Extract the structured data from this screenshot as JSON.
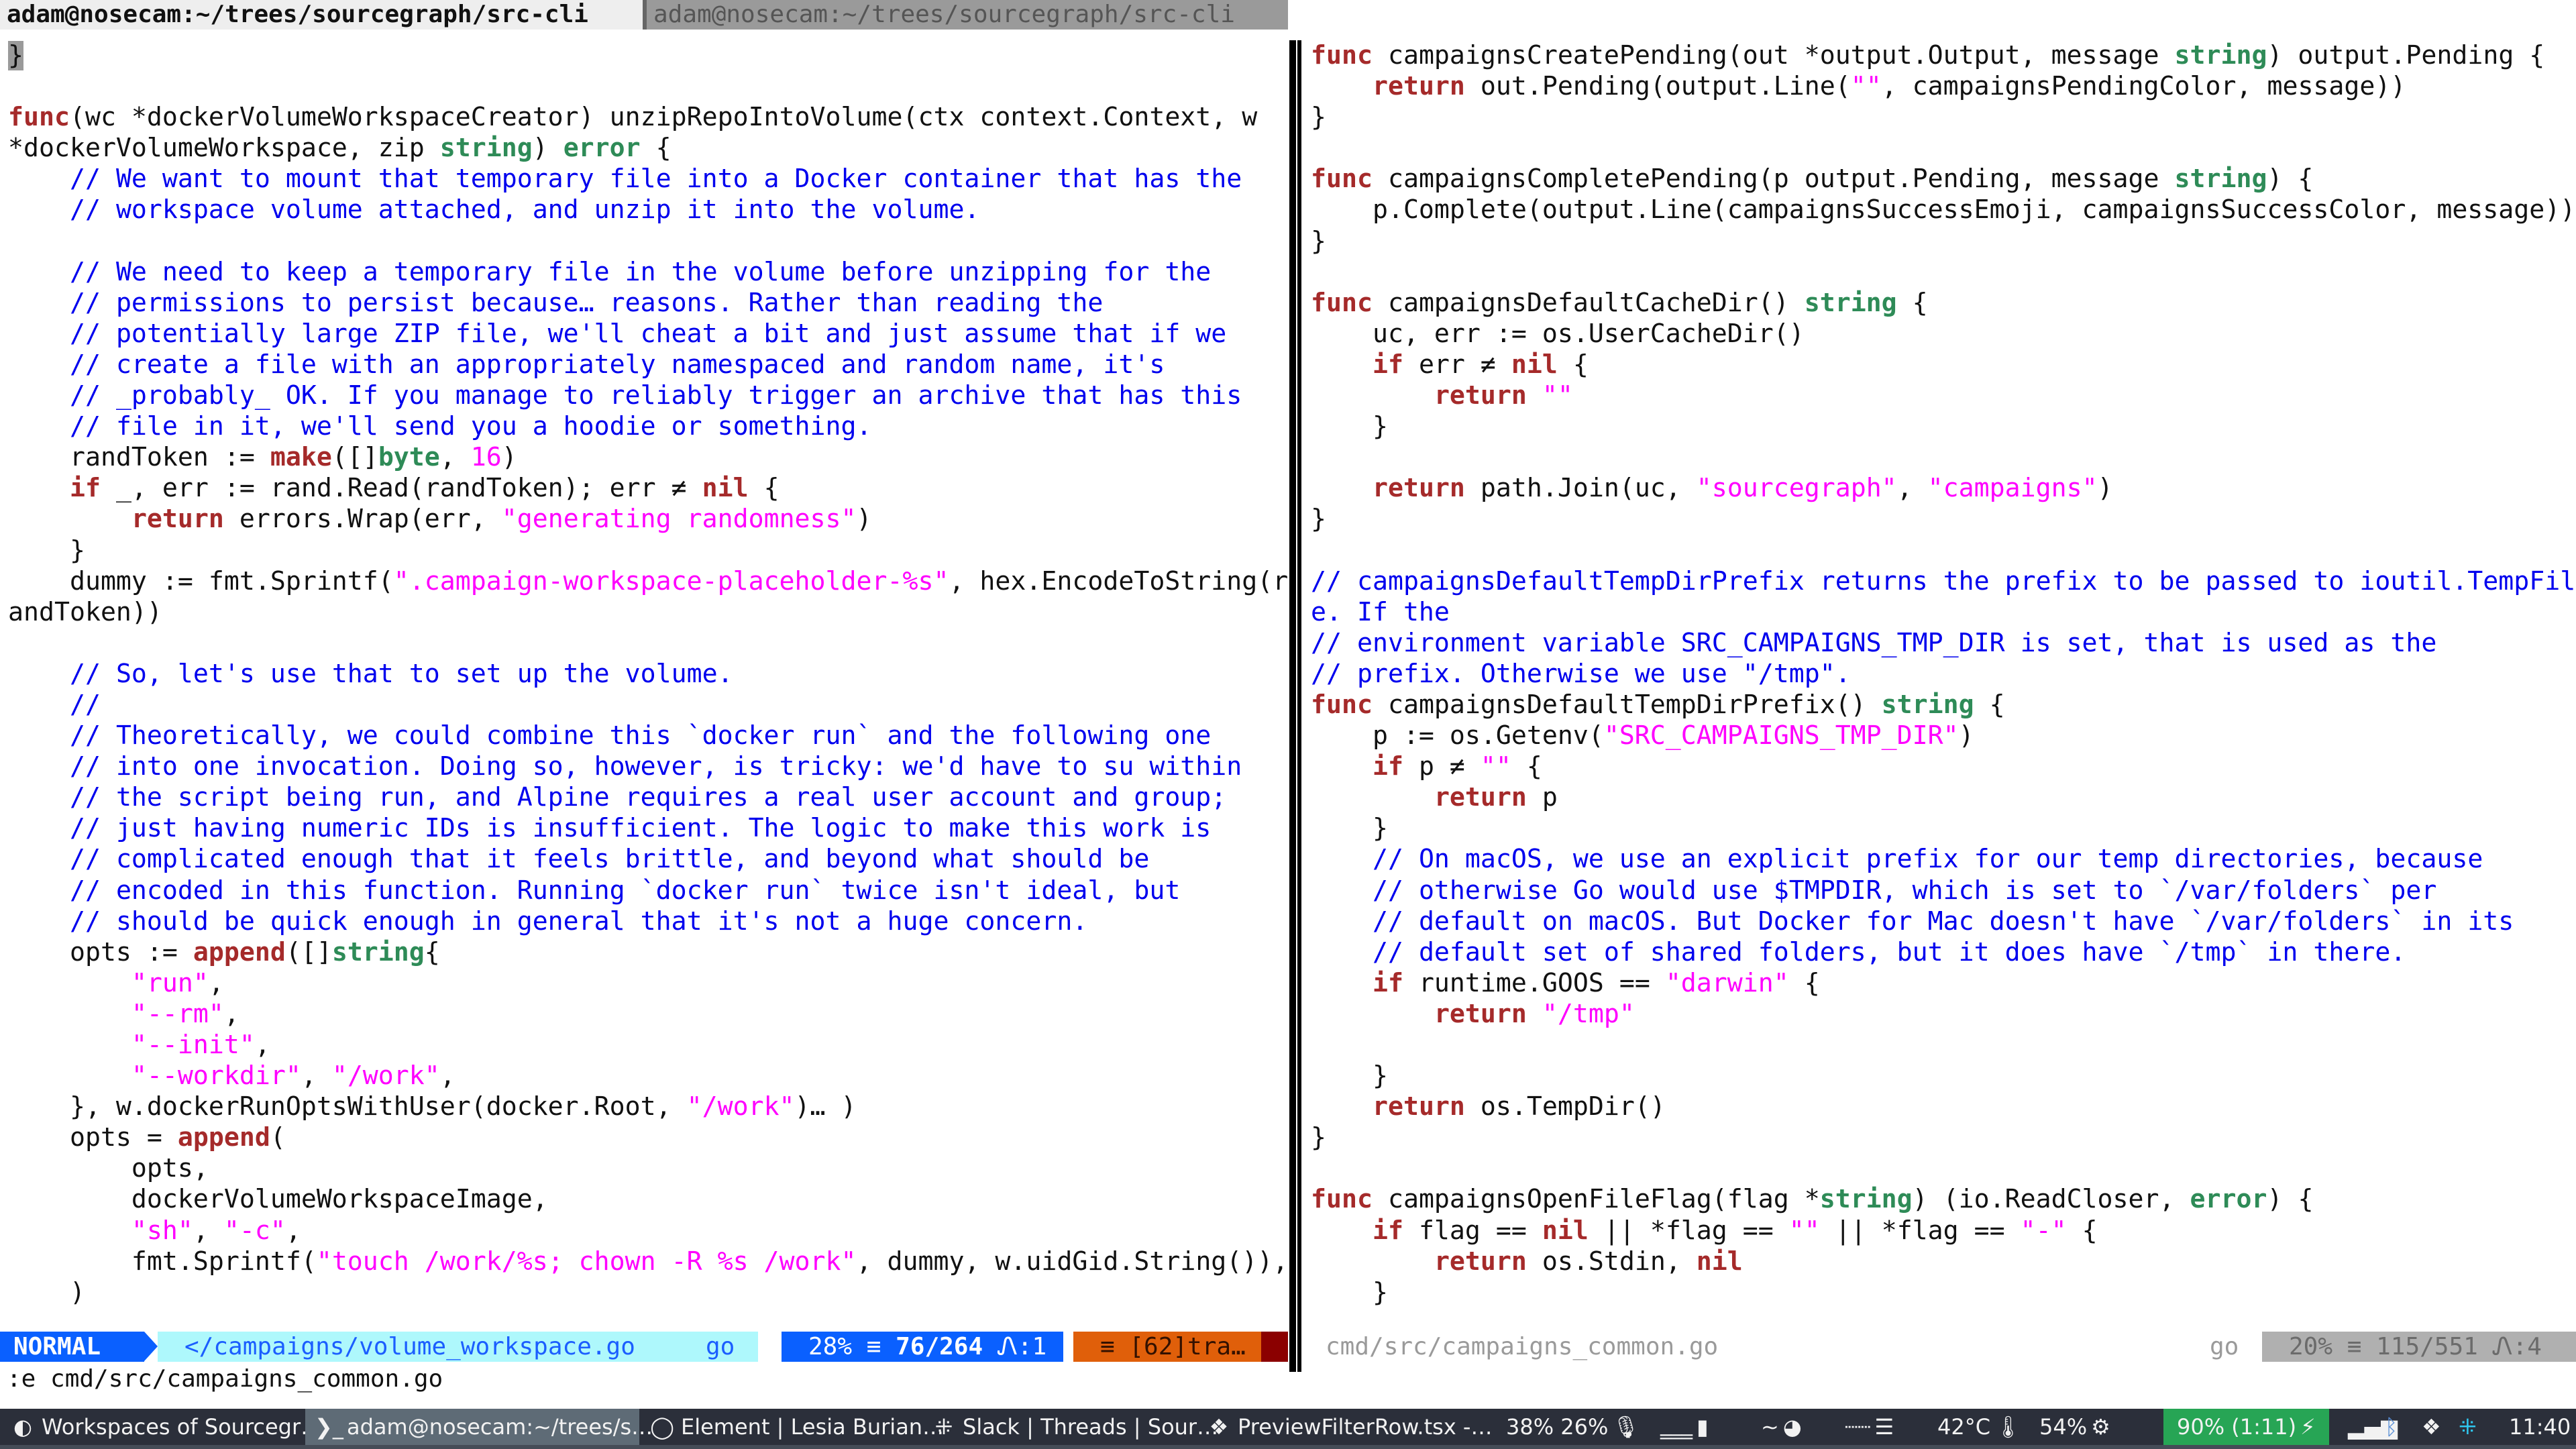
{
  "titlebar": {
    "active_tab": "adam@nosecam:~/trees/sourcegraph/src-cli",
    "inactive_tab": "adam@nosecam:~/trees/sourcegraph/src-cli"
  },
  "left_pane": {
    "file": "volume_workspace.go",
    "lines": [
      [
        [
          "cursor",
          "}"
        ]
      ],
      [],
      [
        [
          "kw",
          "func"
        ],
        [
          "",
          "(wc *dockerVolumeWorkspaceCreator) unzipRepoIntoVolume(ctx context.Context, w"
        ]
      ],
      [
        [
          "",
          "*dockerVolumeWorkspace, zip "
        ],
        [
          "ty",
          "string"
        ],
        [
          "",
          ") "
        ],
        [
          "ty",
          "error"
        ],
        [
          "",
          " {"
        ]
      ],
      [
        [
          "",
          "    "
        ],
        [
          "cm",
          "// We want to mount that temporary file into a Docker container that has the"
        ]
      ],
      [
        [
          "",
          "    "
        ],
        [
          "cm",
          "// workspace volume attached, and unzip it into the volume."
        ]
      ],
      [],
      [
        [
          "",
          "    "
        ],
        [
          "cm",
          "// We need to keep a temporary file in the volume before unzipping for the"
        ]
      ],
      [
        [
          "",
          "    "
        ],
        [
          "cm",
          "// permissions to persist because… reasons. Rather than reading the"
        ]
      ],
      [
        [
          "",
          "    "
        ],
        [
          "cm",
          "// potentially large ZIP file, we'll cheat a bit and just assume that if we"
        ]
      ],
      [
        [
          "",
          "    "
        ],
        [
          "cm",
          "// create a file with an appropriately namespaced and random name, it's"
        ]
      ],
      [
        [
          "",
          "    "
        ],
        [
          "cm",
          "// _probably_ OK. If you manage to reliably trigger an archive that has this"
        ]
      ],
      [
        [
          "",
          "    "
        ],
        [
          "cm",
          "// file in it, we'll send you a hoodie or something."
        ]
      ],
      [
        [
          "",
          "    randToken := "
        ],
        [
          "kw",
          "make"
        ],
        [
          "",
          "([]"
        ],
        [
          "ty",
          "byte"
        ],
        [
          "",
          ", "
        ],
        [
          "nu",
          "16"
        ],
        [
          "",
          ")"
        ]
      ],
      [
        [
          "",
          "    "
        ],
        [
          "kw",
          "if"
        ],
        [
          "",
          " _, err := rand.Read(randToken); err ≠ "
        ],
        [
          "kw",
          "nil"
        ],
        [
          "",
          " {"
        ]
      ],
      [
        [
          "",
          "        "
        ],
        [
          "kw",
          "return"
        ],
        [
          "",
          " errors.Wrap(err, "
        ],
        [
          "st",
          "\"generating randomness\""
        ],
        [
          "",
          ")"
        ]
      ],
      [
        [
          "",
          "    }"
        ]
      ],
      [
        [
          "",
          "    dummy := fmt.Sprintf("
        ],
        [
          "st",
          "\".campaign-workspace-placeholder-%s\""
        ],
        [
          "",
          ", hex.EncodeToString(r"
        ]
      ],
      [
        [
          "",
          "andToken))"
        ]
      ],
      [],
      [
        [
          "",
          "    "
        ],
        [
          "cm",
          "// So, let's use that to set up the volume."
        ]
      ],
      [
        [
          "",
          "    "
        ],
        [
          "cm",
          "//"
        ]
      ],
      [
        [
          "",
          "    "
        ],
        [
          "cm",
          "// Theoretically, we could combine this `docker run` and the following one"
        ]
      ],
      [
        [
          "",
          "    "
        ],
        [
          "cm",
          "// into one invocation. Doing so, however, is tricky: we'd have to su within"
        ]
      ],
      [
        [
          "",
          "    "
        ],
        [
          "cm",
          "// the script being run, and Alpine requires a real user account and group;"
        ]
      ],
      [
        [
          "",
          "    "
        ],
        [
          "cm",
          "// just having numeric IDs is insufficient. The logic to make this work is"
        ]
      ],
      [
        [
          "",
          "    "
        ],
        [
          "cm",
          "// complicated enough that it feels brittle, and beyond what should be"
        ]
      ],
      [
        [
          "",
          "    "
        ],
        [
          "cm",
          "// encoded in this function. Running `docker run` twice isn't ideal, but"
        ]
      ],
      [
        [
          "",
          "    "
        ],
        [
          "cm",
          "// should be quick enough in general that it's not a huge concern."
        ]
      ],
      [
        [
          "",
          "    opts := "
        ],
        [
          "kw",
          "append"
        ],
        [
          "",
          "([]"
        ],
        [
          "ty",
          "string"
        ],
        [
          "",
          "{"
        ]
      ],
      [
        [
          "",
          "        "
        ],
        [
          "st",
          "\"run\""
        ],
        [
          "",
          ","
        ]
      ],
      [
        [
          "",
          "        "
        ],
        [
          "st",
          "\"--rm\""
        ],
        [
          "",
          ","
        ]
      ],
      [
        [
          "",
          "        "
        ],
        [
          "st",
          "\"--init\""
        ],
        [
          "",
          ","
        ]
      ],
      [
        [
          "",
          "        "
        ],
        [
          "st",
          "\"--workdir\""
        ],
        [
          "",
          ", "
        ],
        [
          "st",
          "\"/work\""
        ],
        [
          "",
          ","
        ]
      ],
      [
        [
          "",
          "    }, w.dockerRunOptsWithUser(docker.Root, "
        ],
        [
          "st",
          "\"/work\""
        ],
        [
          "",
          ")… )"
        ]
      ],
      [
        [
          "",
          "    opts = "
        ],
        [
          "kw",
          "append"
        ],
        [
          "",
          "("
        ]
      ],
      [
        [
          "",
          "        opts,"
        ]
      ],
      [
        [
          "",
          "        dockerVolumeWorkspaceImage,"
        ]
      ],
      [
        [
          "",
          "        "
        ],
        [
          "st",
          "\"sh\""
        ],
        [
          "",
          ", "
        ],
        [
          "st",
          "\"-c\""
        ],
        [
          "",
          ","
        ]
      ],
      [
        [
          "",
          "        fmt.Sprintf("
        ],
        [
          "st",
          "\"touch /work/%s; chown -R %s /work\""
        ],
        [
          "",
          ", dummy, w.uidGid.String()),"
        ]
      ],
      [
        [
          "",
          "    )"
        ]
      ]
    ]
  },
  "right_pane": {
    "file": "campaigns_common.go",
    "lines": [
      [
        [
          "kw",
          "func"
        ],
        [
          "",
          " campaignsCreatePending(out *output.Output, message "
        ],
        [
          "ty",
          "string"
        ],
        [
          "",
          ") output.Pending {"
        ]
      ],
      [
        [
          "",
          "    "
        ],
        [
          "kw",
          "return"
        ],
        [
          "",
          " out.Pending(output.Line("
        ],
        [
          "st",
          "\"\""
        ],
        [
          "",
          ", campaignsPendingColor, message))"
        ]
      ],
      [
        [
          "",
          "}"
        ]
      ],
      [],
      [
        [
          "kw",
          "func"
        ],
        [
          "",
          " campaignsCompletePending(p output.Pending, message "
        ],
        [
          "ty",
          "string"
        ],
        [
          "",
          ") {"
        ]
      ],
      [
        [
          "",
          "    p.Complete(output.Line(campaignsSuccessEmoji, campaignsSuccessColor, message))"
        ]
      ],
      [
        [
          "",
          "}"
        ]
      ],
      [],
      [
        [
          "kw",
          "func"
        ],
        [
          "",
          " campaignsDefaultCacheDir() "
        ],
        [
          "ty",
          "string"
        ],
        [
          "",
          " {"
        ]
      ],
      [
        [
          "",
          "    uc, err := os.UserCacheDir()"
        ]
      ],
      [
        [
          "",
          "    "
        ],
        [
          "kw",
          "if"
        ],
        [
          "",
          " err ≠ "
        ],
        [
          "kw",
          "nil"
        ],
        [
          "",
          " {"
        ]
      ],
      [
        [
          "",
          "        "
        ],
        [
          "kw",
          "return"
        ],
        [
          "",
          ""
        ],
        [
          "st",
          " \"\""
        ]
      ],
      [
        [
          "",
          "    }"
        ]
      ],
      [],
      [
        [
          "",
          "    "
        ],
        [
          "kw",
          "return"
        ],
        [
          "",
          " path.Join(uc, "
        ],
        [
          "st",
          "\"sourcegraph\""
        ],
        [
          "",
          ", "
        ],
        [
          "st",
          "\"campaigns\""
        ],
        [
          "",
          ")"
        ]
      ],
      [
        [
          "",
          "}"
        ]
      ],
      [],
      [
        [
          "cm",
          "// campaignsDefaultTempDirPrefix returns the prefix to be passed to ioutil.TempFil"
        ]
      ],
      [
        [
          "cm",
          "e. If the"
        ]
      ],
      [
        [
          "cm",
          "// environment variable SRC_CAMPAIGNS_TMP_DIR is set, that is used as the"
        ]
      ],
      [
        [
          "cm",
          "// prefix. Otherwise we use \"/tmp\"."
        ]
      ],
      [
        [
          "kw",
          "func"
        ],
        [
          "",
          " campaignsDefaultTempDirPrefix() "
        ],
        [
          "ty",
          "string"
        ],
        [
          "",
          " {"
        ]
      ],
      [
        [
          "",
          "    p := os.Getenv("
        ],
        [
          "st",
          "\"SRC_CAMPAIGNS_TMP_DIR\""
        ],
        [
          "",
          ")"
        ]
      ],
      [
        [
          "",
          "    "
        ],
        [
          "kw",
          "if"
        ],
        [
          "",
          " p ≠ "
        ],
        [
          "st",
          "\"\""
        ],
        [
          "",
          " {"
        ]
      ],
      [
        [
          "",
          "        "
        ],
        [
          "kw",
          "return"
        ],
        [
          "",
          " p"
        ]
      ],
      [
        [
          "",
          "    }"
        ]
      ],
      [
        [
          "",
          "    "
        ],
        [
          "cm",
          "// On macOS, we use an explicit prefix for our temp directories, because"
        ]
      ],
      [
        [
          "",
          "    "
        ],
        [
          "cm",
          "// otherwise Go would use $TMPDIR, which is set to `/var/folders` per"
        ]
      ],
      [
        [
          "",
          "    "
        ],
        [
          "cm",
          "// default on macOS. But Docker for Mac doesn't have `/var/folders` in its"
        ]
      ],
      [
        [
          "",
          "    "
        ],
        [
          "cm",
          "// default set of shared folders, but it does have `/tmp` in there."
        ]
      ],
      [
        [
          "",
          "    "
        ],
        [
          "kw",
          "if"
        ],
        [
          "",
          " runtime.GOOS == "
        ],
        [
          "st",
          "\"darwin\""
        ],
        [
          "",
          " {"
        ]
      ],
      [
        [
          "",
          "        "
        ],
        [
          "kw",
          "return"
        ],
        [
          "",
          ""
        ],
        [
          "st",
          " \"/tmp\""
        ]
      ],
      [],
      [
        [
          "",
          "    }"
        ]
      ],
      [
        [
          "",
          "    "
        ],
        [
          "kw",
          "return"
        ],
        [
          "",
          " os.TempDir()"
        ]
      ],
      [
        [
          "",
          "}"
        ]
      ],
      [],
      [
        [
          "kw",
          "func"
        ],
        [
          "",
          " campaignsOpenFileFlag(flag *"
        ],
        [
          "ty",
          "string"
        ],
        [
          "",
          ") (io.ReadCloser, "
        ],
        [
          "ty",
          "error"
        ],
        [
          "",
          ") {"
        ]
      ],
      [
        [
          "",
          "    "
        ],
        [
          "kw",
          "if"
        ],
        [
          "",
          " flag == "
        ],
        [
          "kw",
          "nil"
        ],
        [
          "",
          " || *flag == "
        ],
        [
          "st",
          "\"\""
        ],
        [
          "",
          " || *flag == "
        ],
        [
          "st",
          "\"-\""
        ],
        [
          "",
          " {"
        ]
      ],
      [
        [
          "",
          "        "
        ],
        [
          "kw",
          "return"
        ],
        [
          "",
          " os.Stdin, "
        ],
        [
          "kw",
          "nil"
        ]
      ],
      [
        [
          "",
          "    }"
        ]
      ]
    ]
  },
  "statusline_left": {
    "mode": "NORMAL",
    "file_icon": "code-icon",
    "file_path": "</campaigns/volume_workspace.go",
    "filetype": "go",
    "percent": "28%",
    "line_icon": "≡",
    "position": "76/264",
    "col_icon": "㏑",
    "column": ":1",
    "warnings": "≡ [62]tra…"
  },
  "statusline_right": {
    "file_path": "cmd/src/campaigns_common.go",
    "filetype": "go",
    "percent": "20%",
    "line_icon": "≡",
    "position": "115/551",
    "column": ":4"
  },
  "cmdline": ":e cmd/src/campaigns_common.go",
  "taskbar": {
    "windows": [
      {
        "icon": "firefox-icon",
        "glyph": "◐",
        "label": "Workspaces of Sourcegr…",
        "active": false
      },
      {
        "icon": "terminal-icon",
        "glyph": "❯_",
        "label": "adam@nosecam:~/trees/s…",
        "active": true
      },
      {
        "icon": "chat-bubble-icon",
        "glyph": "💬︎",
        "label": "Element | Lesia Burian…",
        "active": false
      },
      {
        "icon": "slack-icon",
        "glyph": "⁜",
        "label": "Slack | Threads | Sour…",
        "active": false
      },
      {
        "icon": "codepen-icon",
        "glyph": "❖",
        "label": "PreviewFilterRow.tsx -…",
        "active": false
      }
    ],
    "tray": {
      "mic": "38% 26%",
      "memory_icon": "memory-icon",
      "network_icon": "network-graph-icon",
      "disk_icon": "disk-icon",
      "temperature": "42°C",
      "brightness": "54%",
      "battery": "90% (1:11)",
      "clock": "11:40"
    },
    "colors": {
      "battery_bg": "#27a555",
      "bar_bg": "#2b2f3a",
      "active_bg": "#5e6b76"
    }
  }
}
